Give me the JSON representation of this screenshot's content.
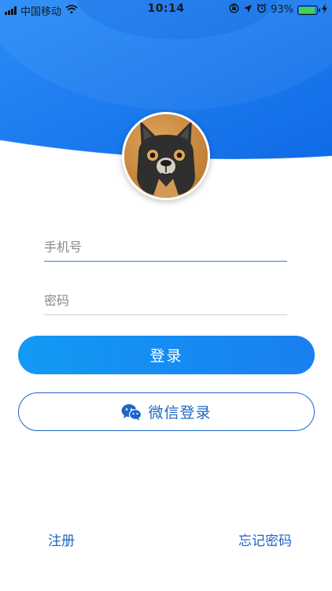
{
  "status_bar": {
    "carrier": "中国移动",
    "time": "10:14",
    "battery_percent": "93%",
    "battery_level": 0.93,
    "icons": [
      "signal-icon",
      "wifi-icon",
      "orientation-lock-icon",
      "location-icon",
      "alarm-icon",
      "battery-icon",
      "charging-icon"
    ]
  },
  "colors": {
    "brand_blue": "#1a7ff0",
    "link_blue": "#1e66c4",
    "header_gradient_start": "#2a8cf8",
    "header_gradient_end": "#0f6be6"
  },
  "form": {
    "phone_placeholder": "手机号",
    "password_placeholder": "密码"
  },
  "buttons": {
    "login_label": "登录",
    "wechat_login_label": "微信登录"
  },
  "links": {
    "register": "注册",
    "forgot_password": "忘记密码"
  }
}
